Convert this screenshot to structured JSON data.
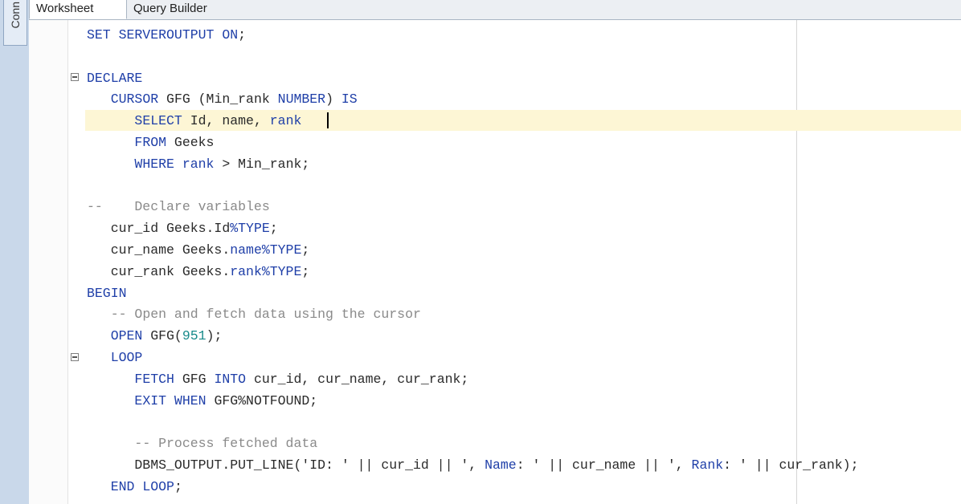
{
  "side_panel": {
    "tab_label": "Conn"
  },
  "tabs": [
    {
      "label": "Worksheet",
      "active": true
    },
    {
      "label": "Query Builder",
      "active": false
    }
  ],
  "colors": {
    "keyword": "#1f3fa8",
    "comment": "#8a8a8a",
    "number": "#178a8a",
    "current_line": "#fdf6d5"
  },
  "editor": {
    "code_lines": [
      [
        {
          "t": "SET SERVEROUTPUT ON",
          "c": "kw"
        },
        {
          "t": ";"
        }
      ],
      [],
      [
        {
          "t": "DECLARE",
          "c": "kw"
        }
      ],
      [
        {
          "t": "   "
        },
        {
          "t": "CURSOR",
          "c": "kw"
        },
        {
          "t": " GFG (Min_rank "
        },
        {
          "t": "NUMBER",
          "c": "kw"
        },
        {
          "t": ") "
        },
        {
          "t": "IS",
          "c": "kw"
        }
      ],
      [
        {
          "t": "      "
        },
        {
          "t": "SELECT",
          "c": "kw"
        },
        {
          "t": " Id, name, "
        },
        {
          "t": "rank",
          "c": "kw"
        }
      ],
      [
        {
          "t": "      "
        },
        {
          "t": "FROM",
          "c": "kw"
        },
        {
          "t": " Geeks"
        }
      ],
      [
        {
          "t": "      "
        },
        {
          "t": "WHERE",
          "c": "kw"
        },
        {
          "t": " "
        },
        {
          "t": "rank",
          "c": "kw"
        },
        {
          "t": " > Min_rank;"
        }
      ],
      [],
      [
        {
          "t": "--    Declare variables",
          "c": "cm"
        }
      ],
      [
        {
          "t": "   cur_id Geeks.Id"
        },
        {
          "t": "%TYPE",
          "c": "kw"
        },
        {
          "t": ";"
        }
      ],
      [
        {
          "t": "   cur_name Geeks."
        },
        {
          "t": "name",
          "c": "kw"
        },
        {
          "t": "%TYPE",
          "c": "kw"
        },
        {
          "t": ";"
        }
      ],
      [
        {
          "t": "   cur_rank Geeks."
        },
        {
          "t": "rank",
          "c": "kw"
        },
        {
          "t": "%TYPE",
          "c": "kw"
        },
        {
          "t": ";"
        }
      ],
      [
        {
          "t": "BEGIN",
          "c": "kw"
        }
      ],
      [
        {
          "t": "   "
        },
        {
          "t": "-- Open and fetch data using the cursor",
          "c": "cm"
        }
      ],
      [
        {
          "t": "   "
        },
        {
          "t": "OPEN",
          "c": "kw"
        },
        {
          "t": " GFG("
        },
        {
          "t": "951",
          "c": "num"
        },
        {
          "t": ");"
        }
      ],
      [
        {
          "t": "   "
        },
        {
          "t": "LOOP",
          "c": "kw"
        }
      ],
      [
        {
          "t": "      "
        },
        {
          "t": "FETCH",
          "c": "kw"
        },
        {
          "t": " GFG "
        },
        {
          "t": "INTO",
          "c": "kw"
        },
        {
          "t": " cur_id, cur_name, cur_rank;"
        }
      ],
      [
        {
          "t": "      "
        },
        {
          "t": "EXIT WHEN",
          "c": "kw"
        },
        {
          "t": " GFG%NOTFOUND;"
        }
      ],
      [],
      [
        {
          "t": "      "
        },
        {
          "t": "-- Process fetched data",
          "c": "cm"
        }
      ],
      [
        {
          "t": "      DBMS_OUTPUT.PUT_LINE('ID: ' || cur_id || ', "
        },
        {
          "t": "Name",
          "c": "kw"
        },
        {
          "t": ": ' || cur_name || ', "
        },
        {
          "t": "Rank",
          "c": "kw"
        },
        {
          "t": ": ' || cur_rank);"
        }
      ],
      [
        {
          "t": "   "
        },
        {
          "t": "END LOOP",
          "c": "kw"
        },
        {
          "t": ";"
        }
      ]
    ]
  }
}
